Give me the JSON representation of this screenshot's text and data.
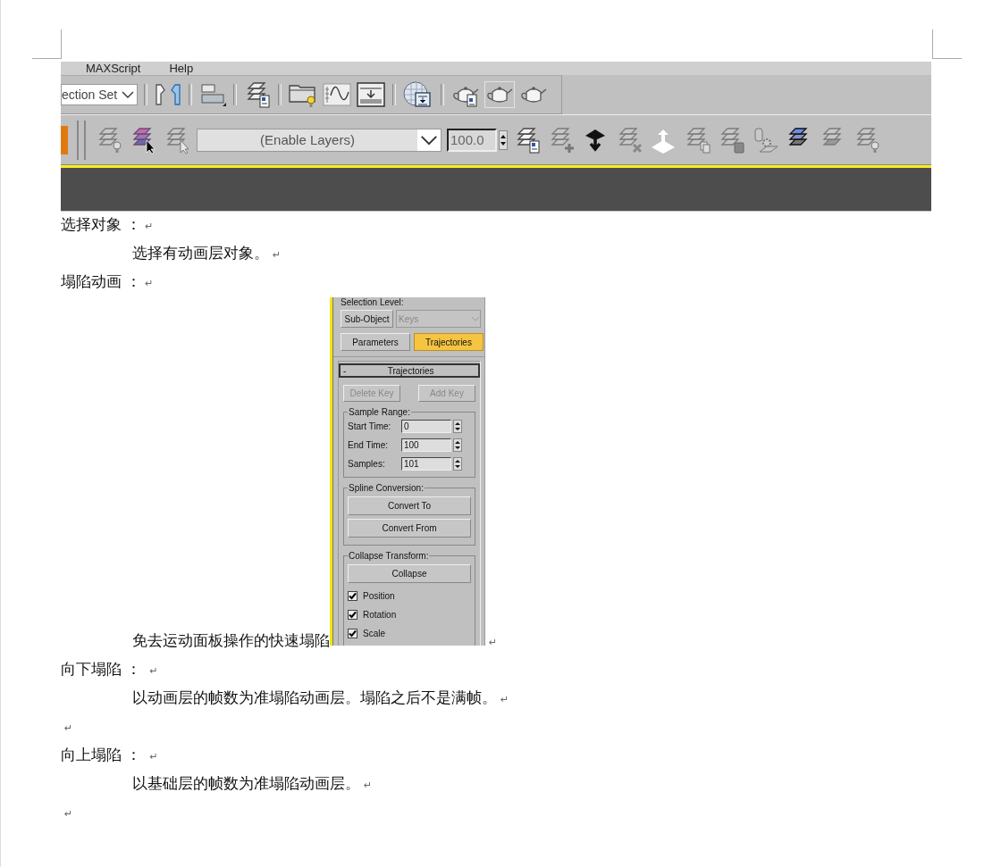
{
  "figure_toolbar": {
    "menu": [
      "MAXScript",
      "Help"
    ],
    "selection_set": "ection Set",
    "layer_dropdown": "(Enable Layers)",
    "weight": "100.0"
  },
  "paragraphs": [
    {
      "kind": "heading",
      "text": "选择对象 ：",
      "mark": "↵"
    },
    {
      "kind": "body",
      "text": "选择有动画层对象。",
      "mark": "↵"
    },
    {
      "kind": "heading",
      "text": "塌陷动画 ：",
      "mark": "↵"
    },
    {
      "kind": "figure",
      "text": "免去运动面板操作的快速塌陷",
      "mark": "↵"
    },
    {
      "kind": "heading",
      "text": "向下塌陷 ： ",
      "mark": "↵"
    },
    {
      "kind": "body",
      "text": "以动画层的帧数为准塌陷动画层。塌陷之后不是满帧。",
      "mark": "↵"
    },
    {
      "kind": "blank",
      "mark": "↵"
    },
    {
      "kind": "heading",
      "text": "向上塌陷 ： ",
      "mark": "↵"
    },
    {
      "kind": "body",
      "text": "以基础层的帧数为准塌陷动画层。",
      "mark": "↵"
    },
    {
      "kind": "blank",
      "mark": "↵"
    }
  ],
  "motion_panel": {
    "selection_level": "Selection Level:",
    "sub_object": "Sub-Object",
    "level_dropdown": {
      "value": "Keys",
      "disabled": true
    },
    "tabs": [
      {
        "label": "Parameters",
        "selected": false
      },
      {
        "label": "Trajectories",
        "selected": true
      }
    ],
    "rollout": {
      "toggle": "-",
      "title": "Trajectories"
    },
    "key_buttons": [
      {
        "label": "Delete Key",
        "disabled": true
      },
      {
        "label": "Add Key",
        "disabled": true
      }
    ],
    "groups": [
      {
        "title": "Sample Range:",
        "fields": [
          {
            "label": "Start Time:",
            "value": "0"
          },
          {
            "label": "End Time:",
            "value": "100"
          },
          {
            "label": "Samples:",
            "value": "101"
          }
        ]
      },
      {
        "title": "Spline Conversion:",
        "buttons": [
          "Convert To",
          "Convert From"
        ]
      },
      {
        "title": "Collapse Transform:",
        "buttons": [
          "Collapse"
        ],
        "checks": [
          {
            "label": "Position",
            "checked": true
          },
          {
            "label": "Rotation",
            "checked": true
          },
          {
            "label": "Scale",
            "checked": true
          }
        ]
      }
    ]
  }
}
